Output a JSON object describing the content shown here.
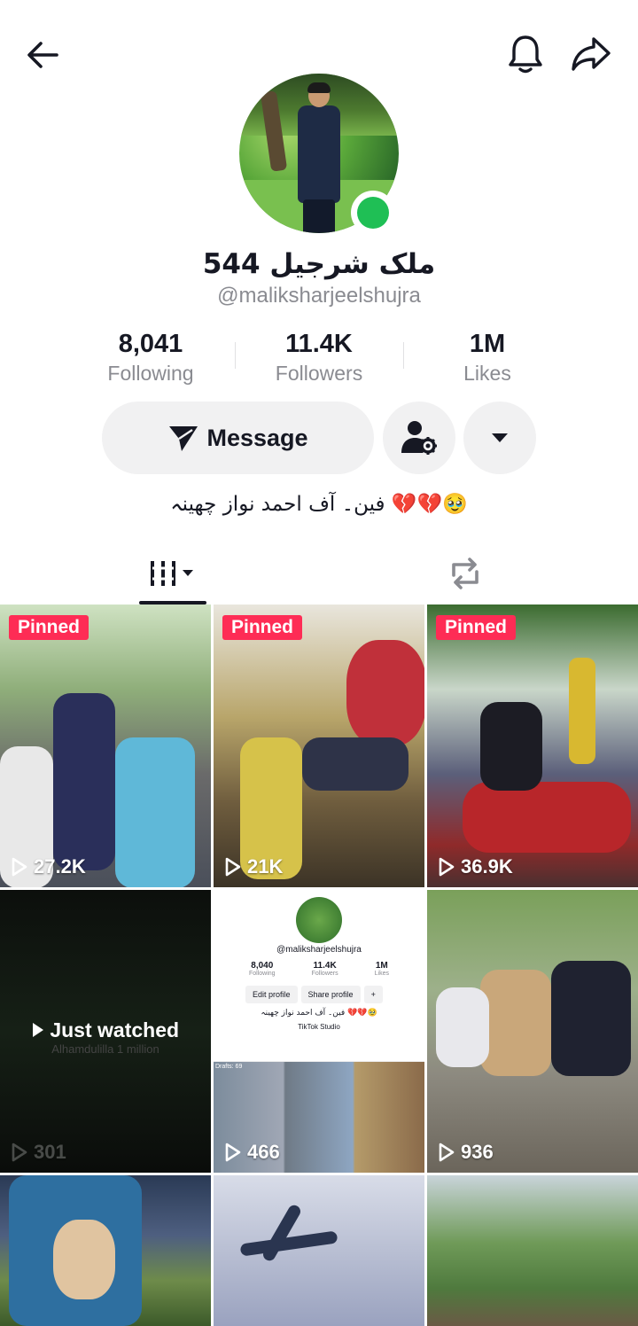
{
  "profile": {
    "display_name": "ملک شرجیل 544",
    "username": "@maliksharjeelshujra",
    "bio": "فین۔ آف احمد نواز چھینہ 💔💔🥹"
  },
  "stats": {
    "following": {
      "value": "8,041",
      "label": "Following"
    },
    "followers": {
      "value": "11.4K",
      "label": "Followers"
    },
    "likes": {
      "value": "1M",
      "label": "Likes"
    }
  },
  "actions": {
    "message_label": "Message"
  },
  "icons": {
    "back": "arrow-left-icon",
    "bell": "bell-icon",
    "share": "share-arrow-icon",
    "message": "paper-plane-icon",
    "suggest": "person-gear-icon",
    "more": "caret-down-icon",
    "videos_tab": "grid-bars-icon",
    "reposts_tab": "repost-icon",
    "play": "play-outline-icon"
  },
  "colors": {
    "pinned": "#fe2c55",
    "online": "#1fbf55",
    "button_bg": "#f1f1f2"
  },
  "videos": [
    {
      "pinned": "Pinned",
      "views": "27.2K"
    },
    {
      "pinned": "Pinned",
      "views": "21K"
    },
    {
      "pinned": "Pinned",
      "views": "36.9K"
    },
    {
      "overlay": "Just watched",
      "sub": "Alhamdulilla 1 million",
      "views": "301"
    },
    {
      "views": "466"
    },
    {
      "views": "936"
    },
    {
      "views": ""
    },
    {
      "views": ""
    },
    {
      "views": ""
    }
  ],
  "mini_screenshot": {
    "username": "@maliksharjeelshujra",
    "following": "8,040",
    "following_label": "Following",
    "followers": "11.4K",
    "followers_label": "Followers",
    "likes": "1M",
    "likes_label": "Likes",
    "edit_profile": "Edit profile",
    "share_profile": "Share profile",
    "bio": "فین۔ آف احمد نواز چھینہ 💔💔🥹",
    "studio": "TikTok Studio",
    "drafts": "Drafts: 69"
  }
}
